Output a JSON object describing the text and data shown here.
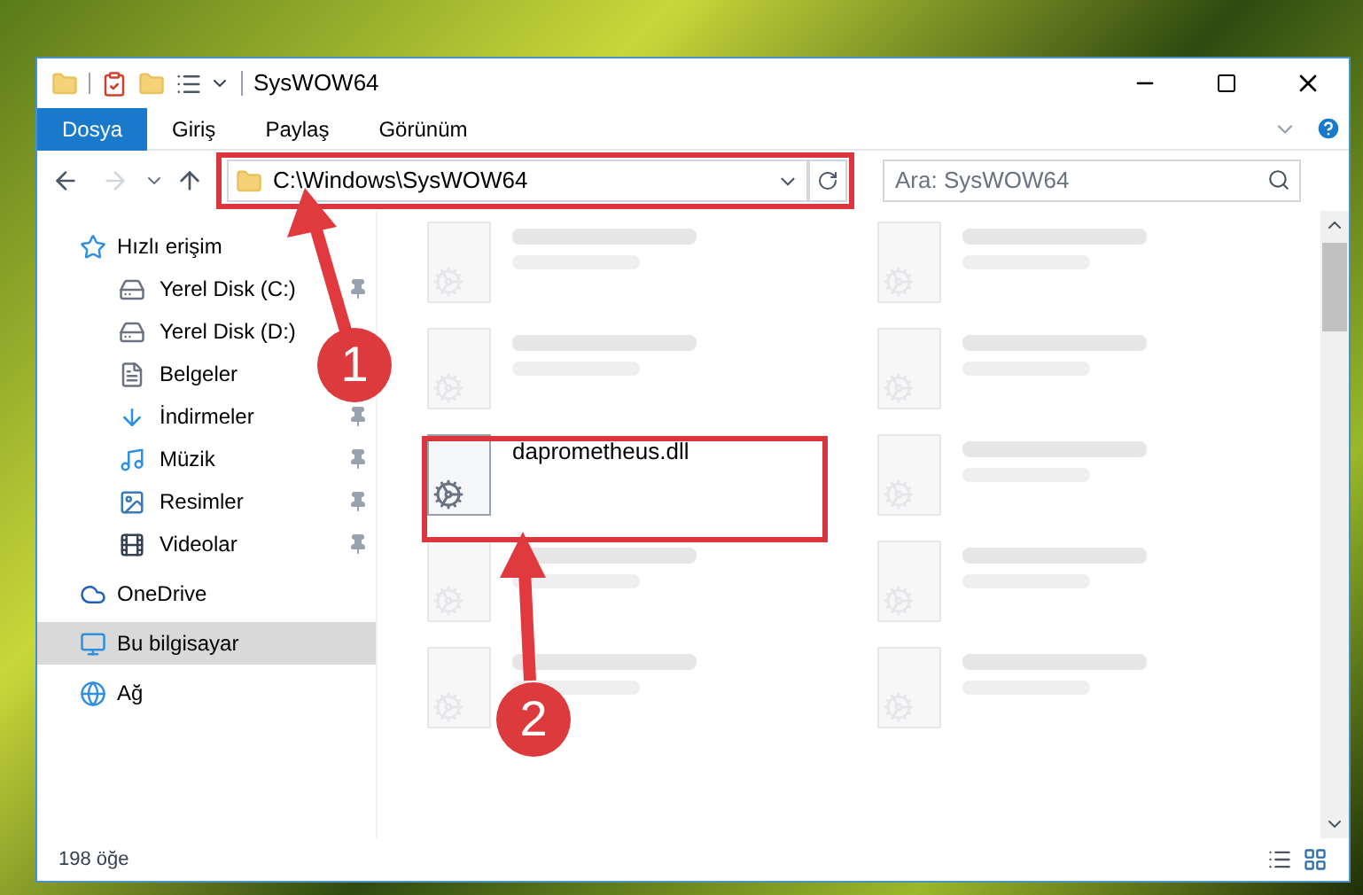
{
  "window": {
    "title": "SysWOW64"
  },
  "ribbon_tabs": [
    {
      "label": "Dosya",
      "selected": true
    },
    {
      "label": "Giriş",
      "selected": false
    },
    {
      "label": "Paylaş",
      "selected": false
    },
    {
      "label": "Görünüm",
      "selected": false
    }
  ],
  "address": {
    "path": "C:\\Windows\\SysWOW64"
  },
  "search": {
    "placeholder": "Ara: SysWOW64"
  },
  "sidebar": {
    "items": [
      {
        "label": "Hızlı erişim",
        "kind": "star",
        "selected": false,
        "children": [
          {
            "label": "Yerel Disk (C:)",
            "kind": "drive",
            "pinned": true
          },
          {
            "label": "Yerel Disk (D:)",
            "kind": "drive"
          },
          {
            "label": "Belgeler",
            "kind": "documents"
          },
          {
            "label": "İndirmeler",
            "kind": "downloads",
            "pinned": true
          },
          {
            "label": "Müzik",
            "kind": "music",
            "pinned": true
          },
          {
            "label": "Resimler",
            "kind": "pictures",
            "pinned": true
          },
          {
            "label": "Videolar",
            "kind": "videos",
            "pinned": true
          }
        ]
      },
      {
        "label": "OneDrive",
        "kind": "cloud",
        "selected": false
      },
      {
        "label": "Bu bilgisayar",
        "kind": "computer",
        "selected": true
      },
      {
        "label": "Ağ",
        "kind": "network",
        "selected": false
      }
    ]
  },
  "files": [
    {
      "blurred": true
    },
    {
      "blurred": true
    },
    {
      "blurred": true
    },
    {
      "blurred": true
    },
    {
      "name": "daprometheus.dll",
      "blurred": false
    },
    {
      "blurred": true
    },
    {
      "blurred": true
    },
    {
      "blurred": true
    },
    {
      "blurred": true
    },
    {
      "blurred": true
    }
  ],
  "status_bar": {
    "item_count": "198 öğe"
  },
  "callouts": [
    {
      "number": "1"
    },
    {
      "number": "2"
    }
  ]
}
